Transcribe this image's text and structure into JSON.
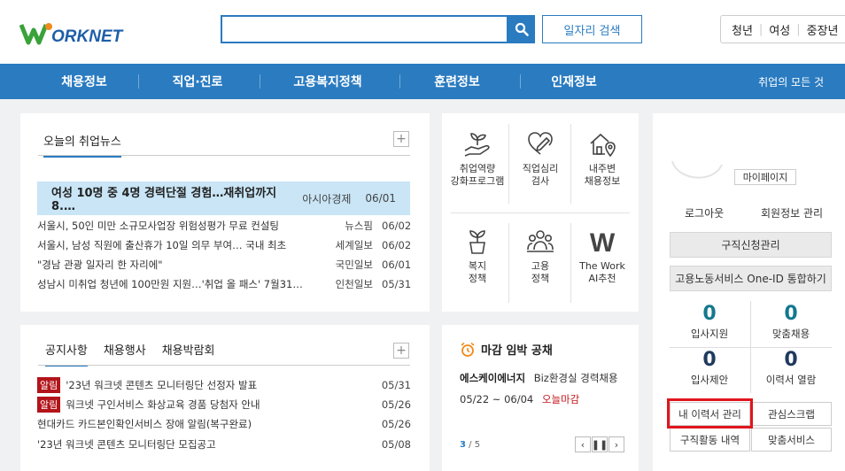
{
  "header": {
    "logo_text": "WORKNET",
    "job_search_label": "일자리 검색",
    "user_tabs": [
      "청년",
      "여성",
      "중장년"
    ]
  },
  "nav": {
    "items": [
      "채용정보",
      "직업·진로",
      "고용복지정책",
      "훈련정보",
      "인재정보"
    ],
    "right_link": "취업의 모든 것"
  },
  "news": {
    "tab_label": "오늘의 취업뉴스",
    "plus": "+",
    "highlight": {
      "title": "여성 10명 중 4명 경력단절 경험…재취업까지 8.…",
      "source": "아시아경제",
      "date": "06/01"
    },
    "rows": [
      {
        "title": "서울시, 50인 미만 소규모사업장 위험성평가 무료 컨설팅",
        "source": "뉴스핌",
        "date": "06/02"
      },
      {
        "title": "서울시, 남성 직원에 출산휴가 10일 의무 부여… 국내 최초",
        "source": "세계일보",
        "date": "06/02"
      },
      {
        "title": "\"경남 관광 일자리 한 자리에\"",
        "source": "국민일보",
        "date": "06/01"
      },
      {
        "title": "성남시 미취업 청년에 100만원 지원…'취업 올 패스' 7월31…",
        "source": "인천일보",
        "date": "05/31"
      }
    ]
  },
  "services": [
    {
      "icon": "sprout-hand-icon",
      "lines": [
        "취업역량",
        "강화프로그램"
      ]
    },
    {
      "icon": "heart-pen-icon",
      "lines": [
        "직업심리",
        "검사"
      ]
    },
    {
      "icon": "house-location-icon",
      "lines": [
        "내주변",
        "채용정보"
      ]
    },
    {
      "icon": "potted-plant-icon",
      "lines": [
        "복지",
        "정책"
      ]
    },
    {
      "icon": "people-group-icon",
      "lines": [
        "고용",
        "정책"
      ]
    },
    {
      "icon": "w-logo-icon",
      "lines": [
        "The Work",
        "AI추천"
      ]
    }
  ],
  "notice": {
    "tabs": [
      "공지사항",
      "채용행사",
      "채용박람회"
    ],
    "plus": "+",
    "rows": [
      {
        "badge": "알림",
        "title": "'23년 워크넷 콘텐츠 모니터링단 선정자 발표",
        "date": "05/31"
      },
      {
        "badge": "알림",
        "title": "워크넷 구인서비스 화상교육 경품 당첨자 안내",
        "date": "05/26"
      },
      {
        "badge": "",
        "title": "현대카드 카드본인확인서비스 장애 알림(복구완료)",
        "date": "05/26"
      },
      {
        "badge": "",
        "title": "'23년 워크넷 콘텐츠 모니터링단 모집공고",
        "date": "05/08"
      }
    ]
  },
  "deadline": {
    "title": "마감 임박 공채",
    "company": "에스케이에너지",
    "job": "Biz환경실 경력채용",
    "date_range": "05/22 ~ 06/04",
    "status": "오늘마감",
    "page_current": "3",
    "page_total": "/ 5"
  },
  "sidebar": {
    "mypage": "마이페이지",
    "logout": "로그아웃",
    "account": "회원정보 관리",
    "apply_mgmt": "구직신청관리",
    "oneid": "고용노동서비스 One-ID 통합하기",
    "stats": [
      {
        "value": "0",
        "label": "입사지원",
        "color": "#13788f"
      },
      {
        "value": "0",
        "label": "맞춤채용",
        "color": "#13788f"
      },
      {
        "value": "0",
        "label": "입사제안",
        "color": "#203a5e"
      },
      {
        "value": "0",
        "label": "이력서 열람",
        "color": "#203a5e"
      }
    ],
    "buttons": [
      "내 이력서 관리",
      "관심스크랩",
      "구직활동 내역",
      "맞춤서비스"
    ]
  }
}
